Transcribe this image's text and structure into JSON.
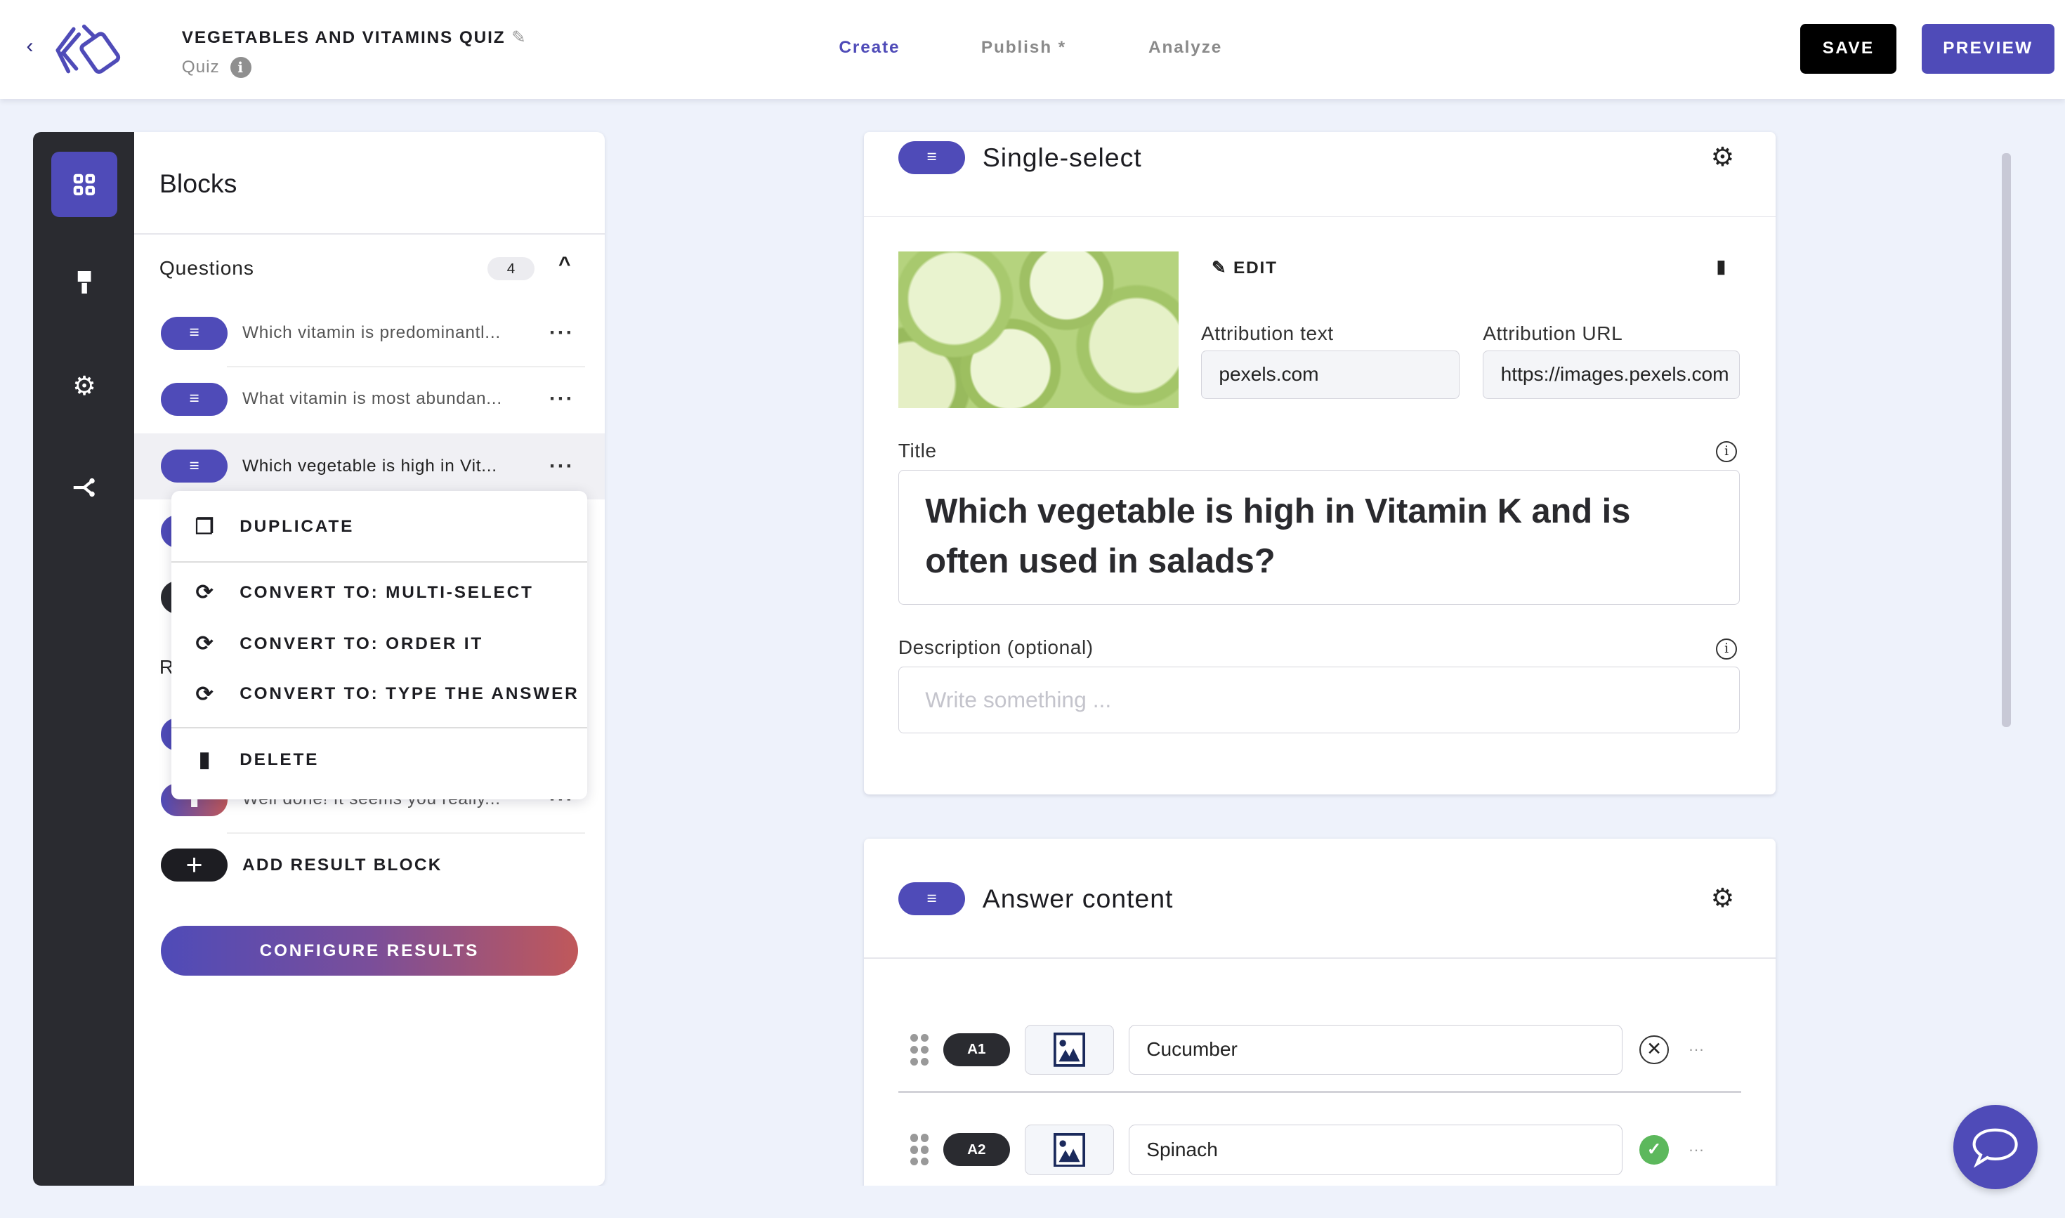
{
  "header": {
    "title": "VEGETABLES AND VITAMINS QUIZ",
    "subtitle": "Quiz",
    "nav": [
      {
        "label": "Create",
        "active": true
      },
      {
        "label": "Publish *",
        "active": false
      },
      {
        "label": "Analyze",
        "active": false
      }
    ],
    "save_label": "SAVE",
    "preview_label": "PREVIEW"
  },
  "colors": {
    "accent": "#4f4bb8",
    "dark": "#2a2b30",
    "background": "#eef2fb",
    "correct": "#5cb85c",
    "gradient_end": "#c0585a"
  },
  "rail": {
    "icons": [
      "blocks-icon",
      "paint-brush-icon",
      "gear-icon",
      "share-icon"
    ]
  },
  "blocks": {
    "title": "Blocks",
    "questions_label": "Questions",
    "questions_count": "4",
    "items": [
      {
        "text": "Which vitamin is predominantl..."
      },
      {
        "text": "What vitamin is most abundan..."
      },
      {
        "text": "Which vegetable is high in Vit..."
      }
    ],
    "results_label_fragment": "R",
    "result_item_text": "Well done! It seems you really...",
    "add_result_label": "ADD RESULT BLOCK",
    "configure_results_label": "CONFIGURE RESULTS"
  },
  "context_menu": {
    "duplicate": "DUPLICATE",
    "convert_multi": "CONVERT TO: MULTI-SELECT",
    "convert_order": "CONVERT TO: ORDER IT",
    "convert_type": "CONVERT TO: TYPE THE ANSWER",
    "delete": "DELETE"
  },
  "question_card": {
    "type_label": "Single-select",
    "edit_label": "EDIT",
    "attribution_text_label": "Attribution text",
    "attribution_text_value": "pexels.com",
    "attribution_url_label": "Attribution URL",
    "attribution_url_value": "https://images.pexels.com",
    "title_label": "Title",
    "title_value": "Which vegetable is high in Vitamin K and is often used in salads?",
    "description_label": "Description (optional)",
    "description_placeholder": "Write something ..."
  },
  "answer_card": {
    "title": "Answer content",
    "answers": [
      {
        "id": "A1",
        "value": "Cucumber",
        "correct": false
      },
      {
        "id": "A2",
        "value": "Spinach",
        "correct": true
      }
    ]
  }
}
